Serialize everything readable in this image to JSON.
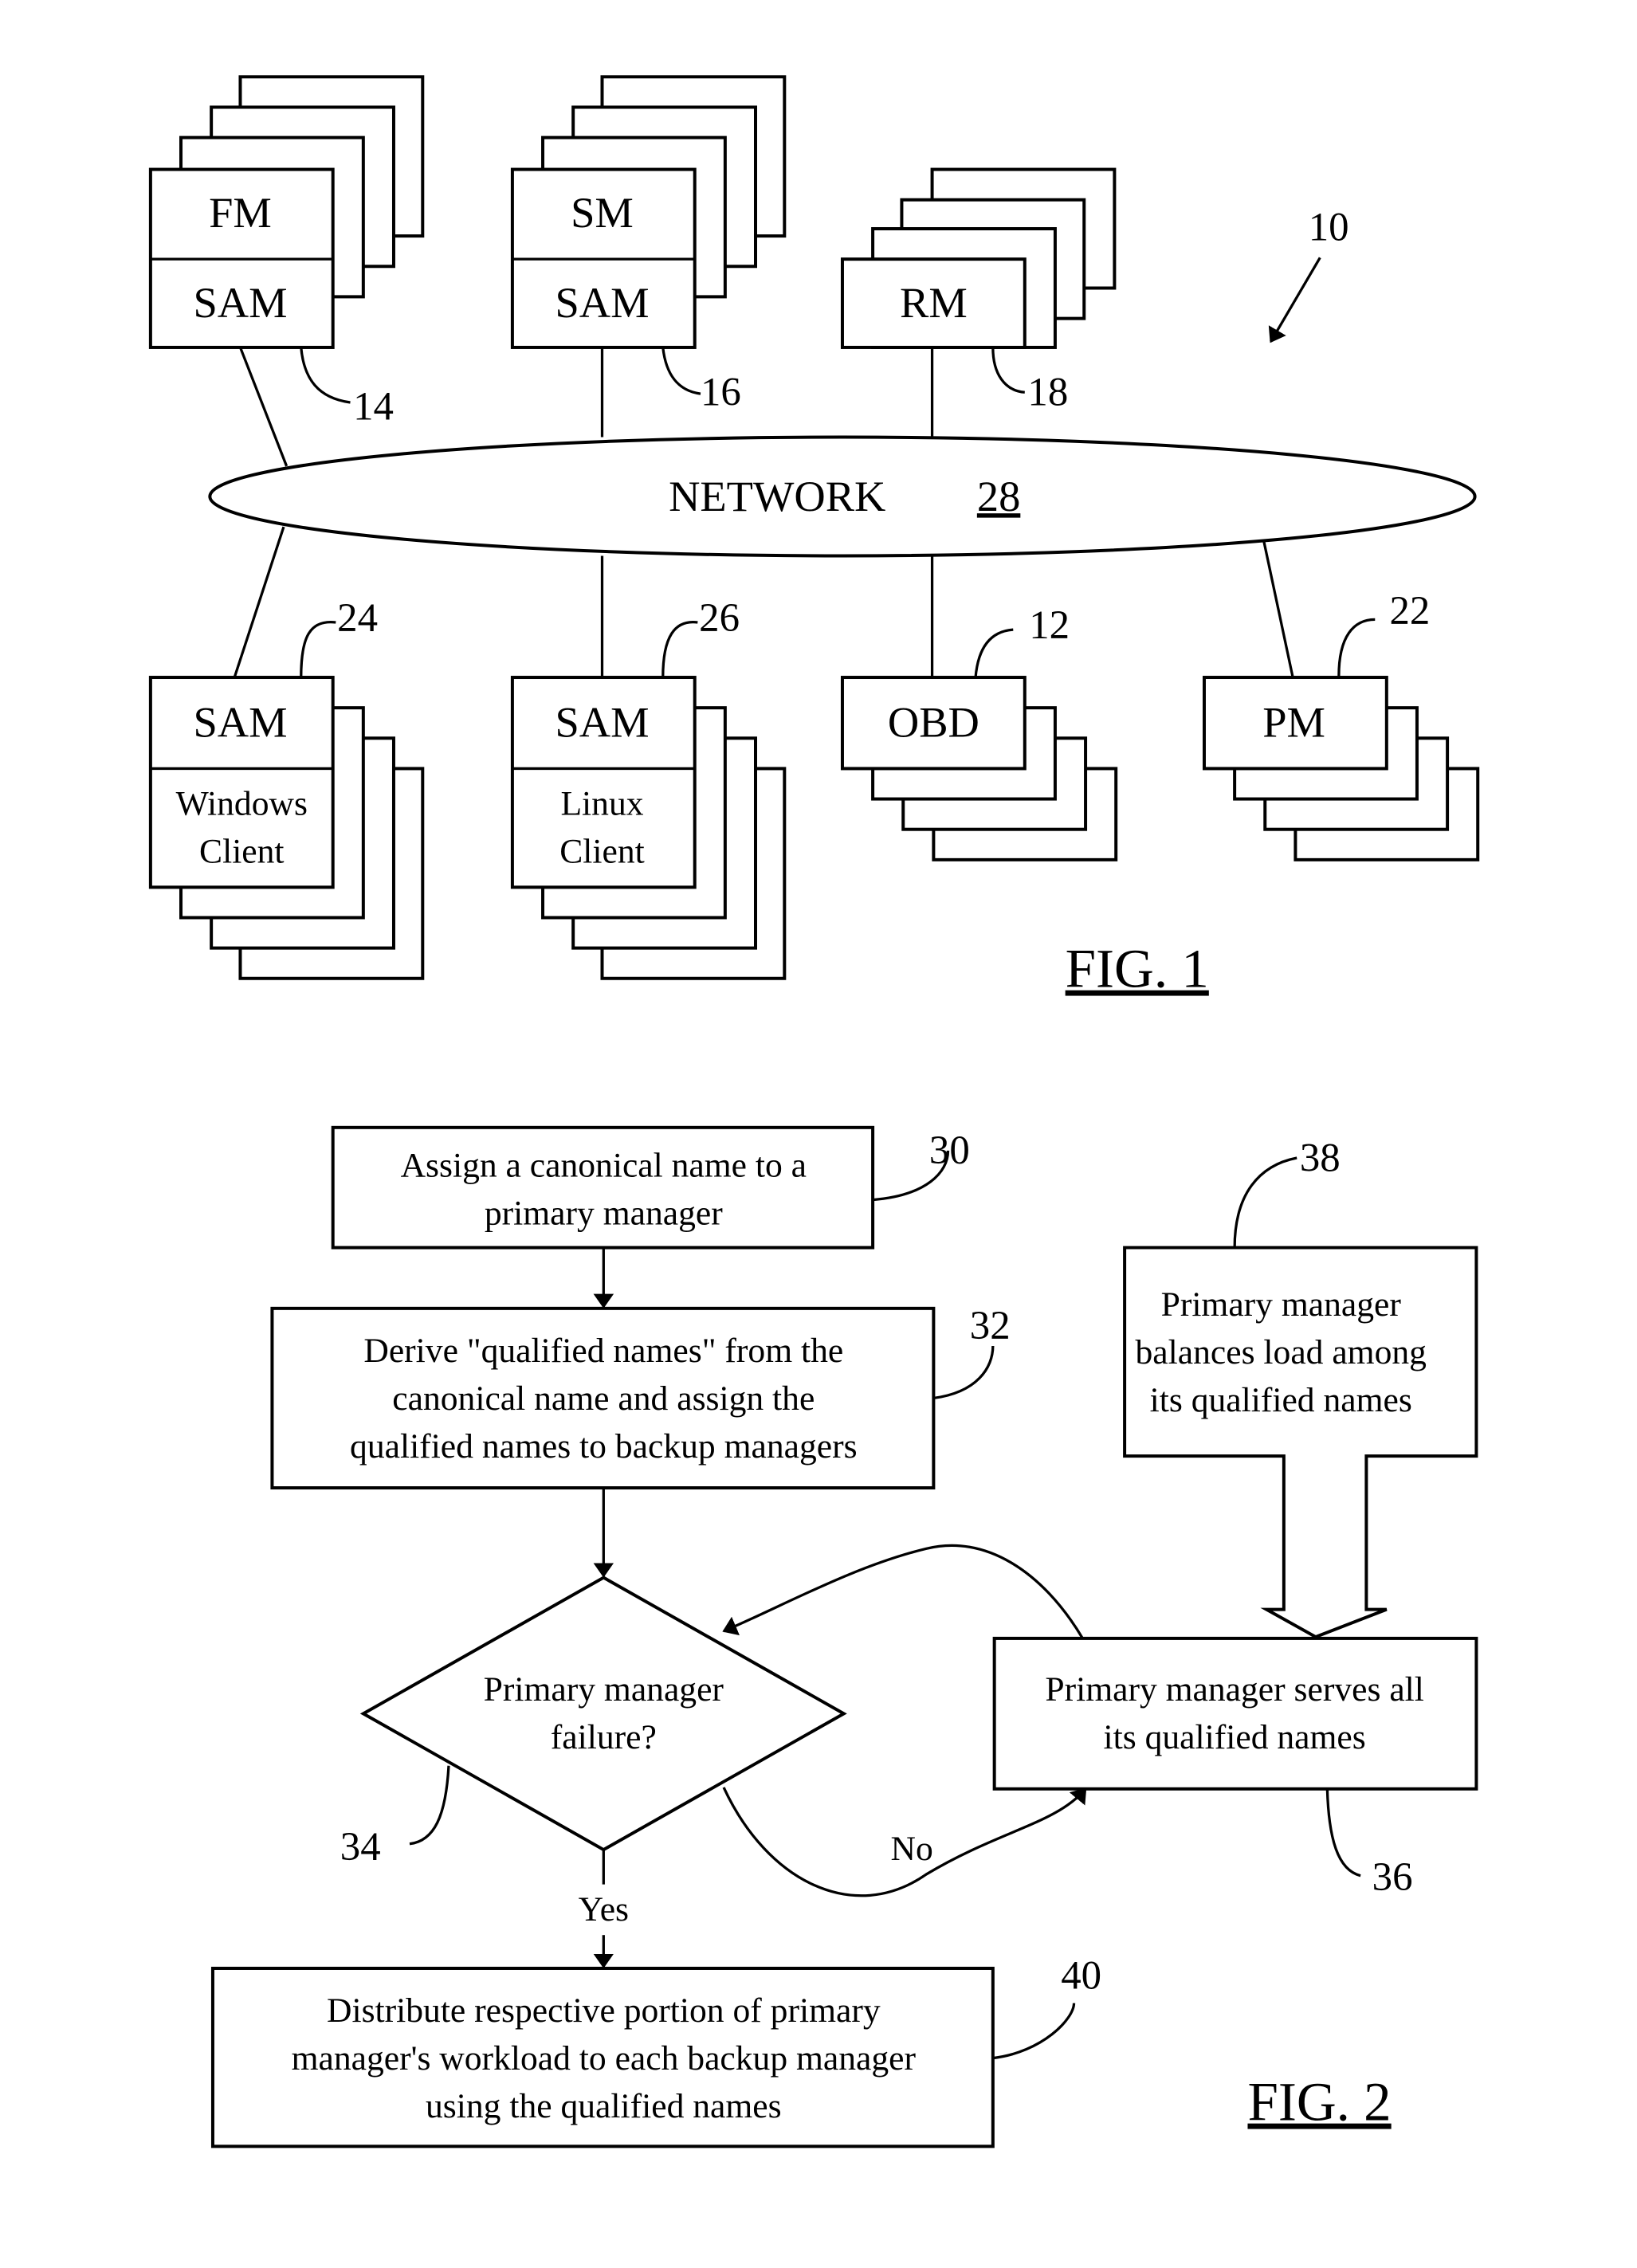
{
  "fig1": {
    "label": "FIG. 1",
    "system_ref": "10",
    "network": {
      "label": "NETWORK",
      "ref": "28"
    },
    "nodes": [
      {
        "id": "fm",
        "top": "FM",
        "bottom": "SAM",
        "ref": "14"
      },
      {
        "id": "sm",
        "top": "SM",
        "bottom": "SAM",
        "ref": "16"
      },
      {
        "id": "rm",
        "top": "RM",
        "ref": "18"
      },
      {
        "id": "windows",
        "top": "SAM",
        "bottom_line1": "Windows",
        "bottom_line2": "Client",
        "ref": "24"
      },
      {
        "id": "linux",
        "top": "SAM",
        "bottom_line1": "Linux",
        "bottom_line2": "Client",
        "ref": "26"
      },
      {
        "id": "obd",
        "top": "OBD",
        "ref": "12"
      },
      {
        "id": "pm",
        "top": "PM",
        "ref": "22"
      }
    ]
  },
  "fig2": {
    "label": "FIG. 2",
    "steps": [
      {
        "ref": "30",
        "lines": [
          "Assign a canonical name to a",
          "primary manager"
        ]
      },
      {
        "ref": "32",
        "lines": [
          "Derive \"qualified names\" from the",
          "canonical name and assign the",
          "qualified names to backup managers"
        ]
      },
      {
        "ref": "34",
        "lines": [
          "Primary manager",
          "failure?"
        ]
      },
      {
        "ref": "36",
        "lines": [
          "Primary manager serves all",
          "its qualified names"
        ]
      },
      {
        "ref": "38",
        "lines": [
          "Primary manager",
          "balances load among",
          "its qualified names"
        ]
      },
      {
        "ref": "40",
        "lines": [
          "Distribute respective portion of primary",
          "manager's workload to each backup manager",
          "using the qualified names"
        ]
      }
    ],
    "yes_label": "Yes",
    "no_label": "No"
  }
}
